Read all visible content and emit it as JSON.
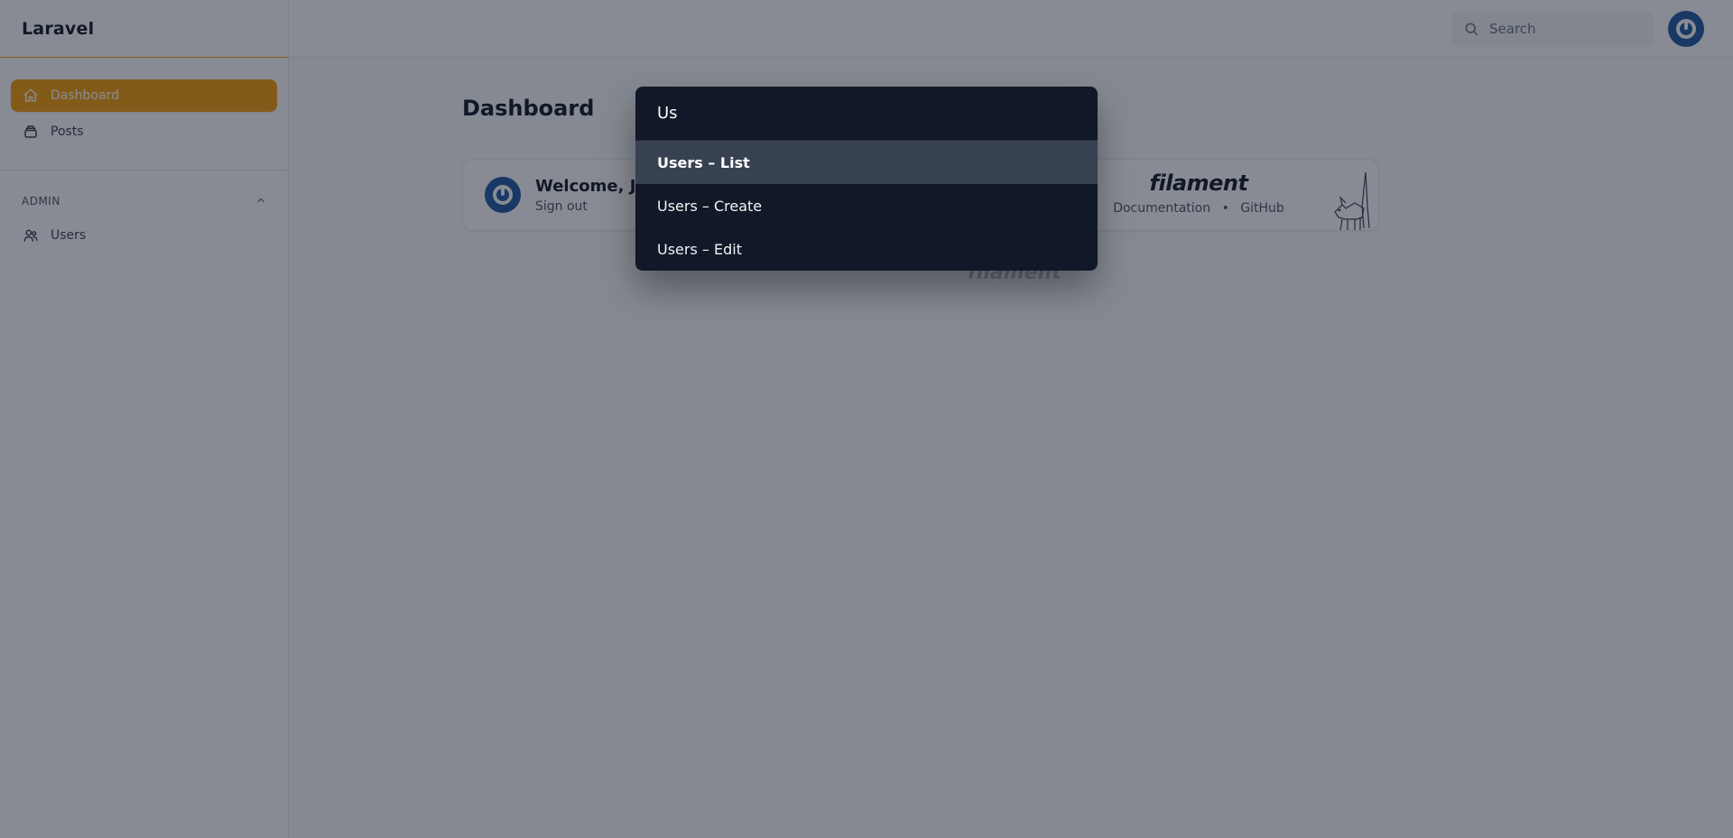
{
  "brand": "Laravel",
  "sidebar": {
    "items": [
      {
        "label": "Dashboard",
        "icon": "home-icon",
        "active": true
      },
      {
        "label": "Posts",
        "icon": "collection-icon",
        "active": false
      }
    ],
    "groups": [
      {
        "label": "ADMIN",
        "collapse_icon": "chevron-up-icon",
        "items": [
          {
            "label": "Users",
            "icon": "users-icon"
          }
        ]
      }
    ]
  },
  "topbar": {
    "search_placeholder": "Search",
    "search_icon": "search-icon"
  },
  "page": {
    "title": "Dashboard"
  },
  "account_widget": {
    "greeting": "Welcome, Jo",
    "signout": "Sign out"
  },
  "filament_widget": {
    "logo": "filament",
    "links": [
      {
        "label": "Documentation"
      },
      {
        "label": "GitHub"
      }
    ],
    "separator": "•"
  },
  "footer": {
    "brand": "filament"
  },
  "search_modal": {
    "query": "Us",
    "results": [
      {
        "label": "Users – List",
        "highlighted": true
      },
      {
        "label": "Users – Create",
        "highlighted": false
      },
      {
        "label": "Users – Edit",
        "highlighted": false
      }
    ]
  },
  "colors": {
    "primary": "#f59e0b",
    "avatar": "#1e5aa3",
    "modal_bg": "#111827",
    "highlight_bg": "#374151",
    "overlay": "rgba(17,24,39,0.5)"
  }
}
